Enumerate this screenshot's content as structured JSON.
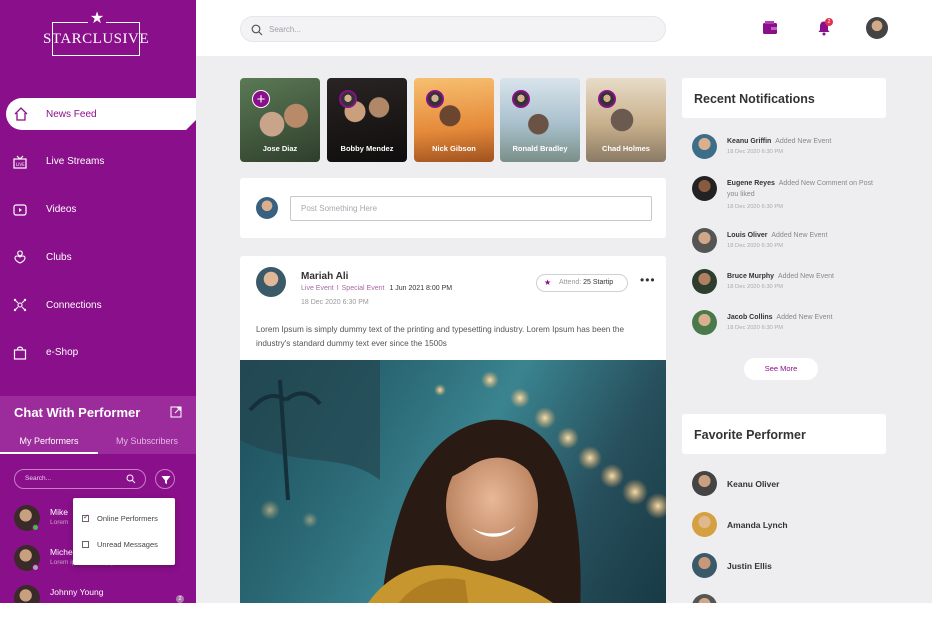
{
  "app": {
    "logo_text": "STARCLUSIVE"
  },
  "search": {
    "placeholder": "Search..."
  },
  "header": {
    "notification_count": "2"
  },
  "sidebar": {
    "items": [
      {
        "label": "News Feed",
        "icon": "home-icon",
        "active": true
      },
      {
        "label": "Live Streams",
        "icon": "live-tv-icon",
        "active": false
      },
      {
        "label": "Videos",
        "icon": "video-icon",
        "active": false
      },
      {
        "label": "Clubs",
        "icon": "clubs-icon",
        "active": false
      },
      {
        "label": "Connections",
        "icon": "connections-icon",
        "active": false
      },
      {
        "label": "e-Shop",
        "icon": "shopping-bag-icon",
        "active": false
      }
    ]
  },
  "chat": {
    "title": "Chat With Performer",
    "tabs": [
      "My Performers",
      "My Subscribers"
    ],
    "search_placeholder": "Search...",
    "rows": [
      {
        "name": "Mike",
        "msg": "Lorem"
      },
      {
        "name": "Miche",
        "msg": "Lorem ipsum is simply. Nov 12"
      },
      {
        "name": "Johnny Young",
        "msg": "",
        "badge": "2"
      }
    ],
    "filter_options": [
      {
        "label": "Online Performers",
        "checked": true
      },
      {
        "label": "Unread Messages",
        "checked": false
      }
    ]
  },
  "stories": [
    {
      "name": "",
      "add": true
    },
    {
      "name": "Jose Diaz"
    },
    {
      "name": "Bobby Mendez"
    },
    {
      "name": "Nick Gibson"
    },
    {
      "name": "Ronald Bradley"
    },
    {
      "name": "Chad Holmes"
    }
  ],
  "composer": {
    "placeholder": "Post Something Here"
  },
  "post": {
    "author": "Mariah Ali",
    "tag1": "Live Event",
    "tag_sep": "I",
    "tag2": "Special Event",
    "event_date": "1 Jun 2021  8:00 PM",
    "posted": "18 Dec 2020  6:30 PM",
    "attend_label": "Attend:",
    "attend_value": "25 Startip",
    "more": "•••",
    "text": "Lorem Ipsum is simply dummy text of the printing and typesetting industry. Lorem Ipsum has been the industry's standard dummy text ever since the 1500s"
  },
  "notifications": {
    "title": "Recent Notifications",
    "items": [
      {
        "name": "Keanu Griffin",
        "action": "Added New Event",
        "time": "18 Dec 2020  6:30 PM"
      },
      {
        "name": "Eugene Reyes",
        "action": "Added New Comment on Post you liked",
        "time": "18 Dec 2020  6:30 PM"
      },
      {
        "name": "Louis Oliver",
        "action": "Added New Event",
        "time": "18 Dec 2020  6:30 PM"
      },
      {
        "name": "Bruce Murphy",
        "action": "Added New Event",
        "time": "18 Dec 2020  6:30 PM"
      },
      {
        "name": "Jacob Collins",
        "action": "Added New Event",
        "time": "18 Dec 2020  6:30 PM"
      }
    ],
    "see_more": "See More"
  },
  "favorites": {
    "title": "Favorite Performer",
    "items": [
      {
        "name": "Keanu Oliver"
      },
      {
        "name": "Amanda Lynch"
      },
      {
        "name": "Justin Ellis"
      }
    ]
  },
  "colors": {
    "brand": "#8a0f8a",
    "accent_badge": "#e0344c"
  }
}
